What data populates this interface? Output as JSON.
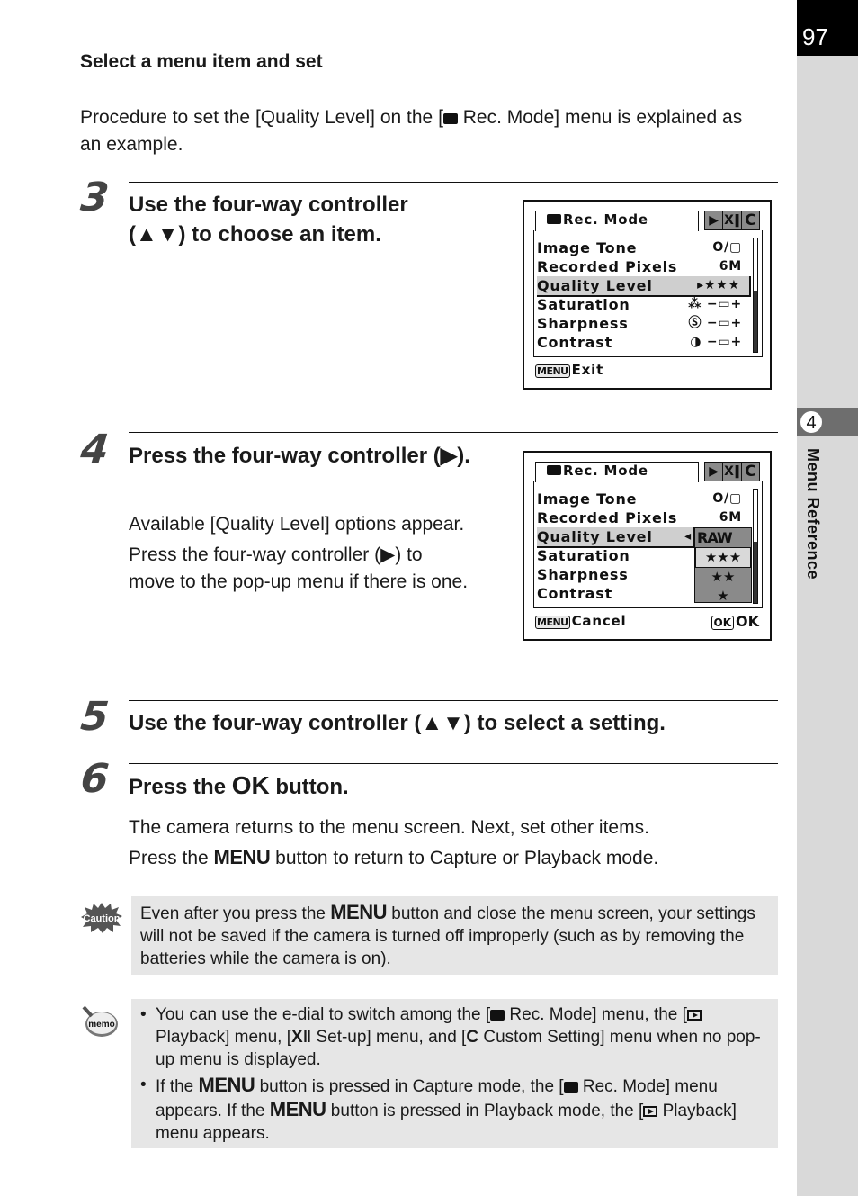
{
  "page": {
    "number": "97",
    "chapter_number": "4",
    "chapter_title": "Menu Reference"
  },
  "intro": {
    "heading": "Select a menu item and set",
    "text_before": "Procedure to set the [Quality Level] on the [",
    "text_after": " Rec. Mode] menu is explained as an example."
  },
  "steps": [
    {
      "number": "3",
      "heading": "Use the four-way controller (▲▼) to choose an item.",
      "body": []
    },
    {
      "number": "4",
      "heading": "Press the four-way controller (▶).",
      "body": [
        "Available [Quality Level] options appear.",
        "Press the four-way controller (▶) to move to the pop-up menu if there is one."
      ]
    },
    {
      "number": "5",
      "heading": "Use the four-way controller (▲▼) to select a setting.",
      "body": []
    },
    {
      "number": "6",
      "heading_before": "Press the ",
      "heading_glyph": "OK",
      "heading_after": " button.",
      "body_line1": "The camera returns to the menu screen. Next, set other items.",
      "body_line2_before": "Press the ",
      "body_line2_glyph": "MENU",
      "body_line2_after": " button to return to Capture or Playback mode."
    }
  ],
  "screen1": {
    "tab_title": "Rec. Mode",
    "tab_icons": [
      "▶",
      "X‖",
      "C"
    ],
    "items": [
      {
        "label": "Image Tone",
        "value": "O/▢"
      },
      {
        "label": "Recorded Pixels",
        "value": "6M"
      },
      {
        "label": "Quality Level",
        "value": "▸★★★",
        "selected": true
      },
      {
        "label": "Saturation",
        "value": "⁂ −▭+"
      },
      {
        "label": "Sharpness",
        "value": "Ⓢ −▭+"
      },
      {
        "label": "Contrast",
        "value": "◑ −▭+"
      }
    ],
    "footer_key": "MENU",
    "footer_label": "Exit"
  },
  "screen2": {
    "tab_title": "Rec. Mode",
    "tab_icons": [
      "▶",
      "X‖",
      "C"
    ],
    "items": [
      {
        "label": "Image Tone",
        "value": "O/▢"
      },
      {
        "label": "Recorded Pixels",
        "value": "6M"
      },
      {
        "label": "Quality Level",
        "value": "◂",
        "selected": true
      },
      {
        "label": "Saturation",
        "value": ""
      },
      {
        "label": "Sharpness",
        "value": ""
      },
      {
        "label": "Contrast",
        "value": ""
      }
    ],
    "popup_options": [
      "RAW",
      "★★★",
      "★★",
      "★"
    ],
    "popup_selected": "★★★",
    "footer_key": "MENU",
    "footer_label": "Cancel",
    "ok_key": "OK",
    "ok_label": "OK"
  },
  "caution": {
    "icon_label": "Caution",
    "text_before": "Even after you press the ",
    "glyph": "MENU",
    "text_after": " button and close the menu screen, your settings will not be saved if the camera is turned off improperly (such as by removing the batteries while the camera is on)."
  },
  "memo": {
    "icon_label": "memo",
    "bullet1": {
      "t1": "You can use the e-dial to switch among the [",
      "t2": " Rec. Mode] menu, the [",
      "t3": " Playback] menu, [",
      "setup_glyph": "X‖",
      "t4": " Set-up] menu, and [",
      "c_glyph": "C",
      "t5": " Custom Setting] menu when no pop-up menu is displayed."
    },
    "bullet2": {
      "t1": "If the ",
      "glyph": "MENU",
      "t2": " button is pressed in Capture mode, the [",
      "t3": " Rec. Mode] menu appears. If the ",
      "t4": " button is pressed in Playback mode, the [",
      "t5": " Playback] menu appears."
    }
  }
}
